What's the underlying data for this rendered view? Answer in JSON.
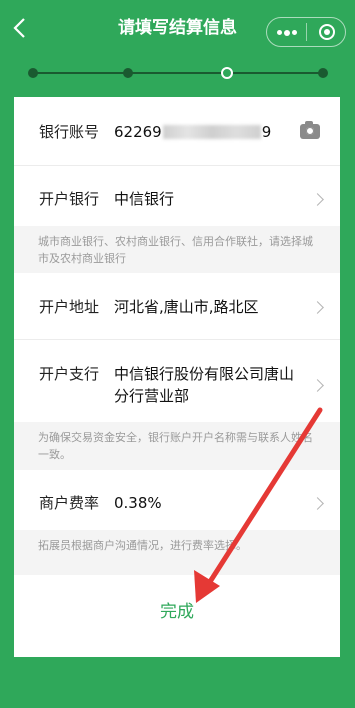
{
  "header": {
    "title": "请填写结算信息"
  },
  "steps": {
    "count": 4,
    "current_index": 2
  },
  "form": {
    "account": {
      "label": "银行账号",
      "value_prefix": "62269",
      "value_suffix": "9"
    },
    "bank": {
      "label": "开户银行",
      "value": "中信银行"
    },
    "bank_hint": "城市商业银行、农村商业银行、信用合作联社，请选择城市及农村商业银行",
    "address": {
      "label": "开户地址",
      "value": "河北省,唐山市,路北区"
    },
    "branch": {
      "label": "开户支行",
      "value": "中信银行股份有限公司唐山分行营业部"
    },
    "branch_hint": "为确保交易资金安全，银行账户开户名称需与联系人姓名一致。",
    "rate": {
      "label": "商户费率",
      "value": "0.38%"
    },
    "rate_hint": "拓展员根据商户沟通情况，进行费率选择。"
  },
  "actions": {
    "done_label": "完成"
  },
  "colors": {
    "brand": "#2fa85a",
    "annotation_arrow": "#e53935"
  }
}
